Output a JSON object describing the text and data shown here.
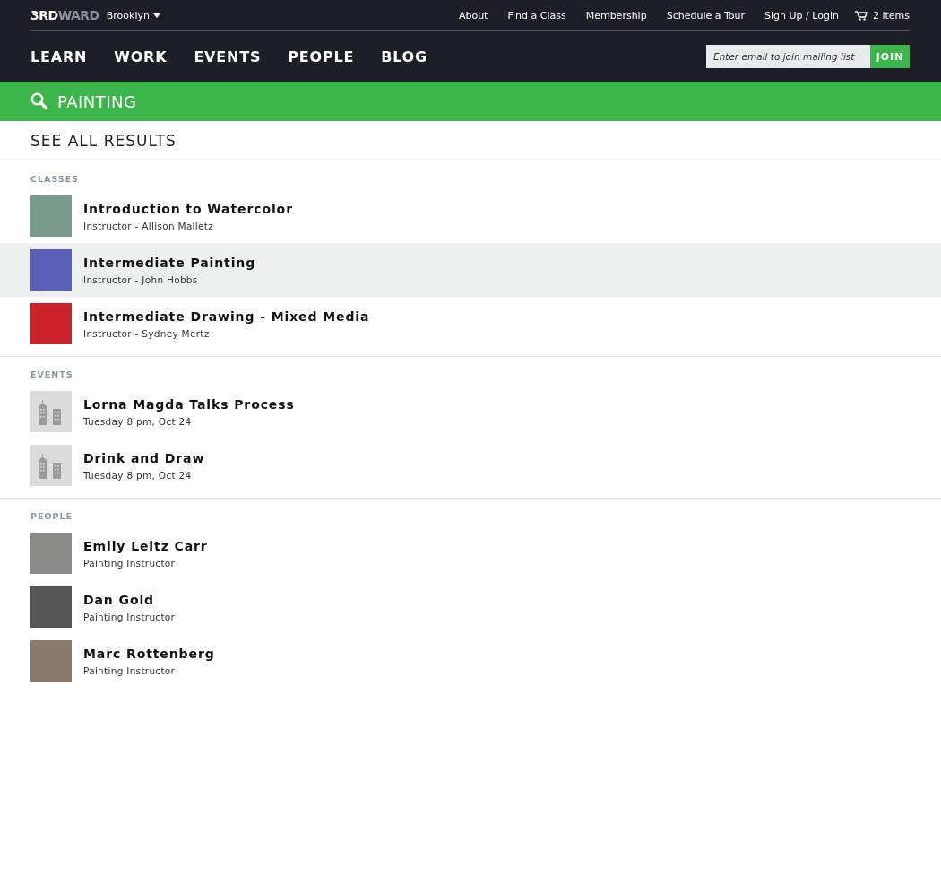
{
  "header": {
    "logo": {
      "light": "3RD",
      "muted": "WARD"
    },
    "location": "Brooklyn",
    "top_links": [
      "About",
      "Find a Class",
      "Membership",
      "Schedule a Tour",
      "Sign Up / Login"
    ],
    "cart": "2 items",
    "nav": [
      "LEARN",
      "WORK",
      "EVENTS",
      "PEOPLE",
      "BLOG"
    ],
    "mailing": {
      "placeholder": "Enter email to join mailing list",
      "button": "JOIN"
    }
  },
  "search": {
    "query": "PAINTING"
  },
  "see_all": "SEE ALL RESULTS",
  "sections": [
    {
      "label": "CLASSES",
      "items": [
        {
          "kind": "photo",
          "title": "Introduction to Watercolor",
          "subtitle": "Instructor - Allison Malletz",
          "highlighted": false,
          "color": "#7a9a8e"
        },
        {
          "kind": "photo",
          "title": "Intermediate Painting",
          "subtitle": "Instructor - John Hobbs",
          "highlighted": true,
          "color": "#5a5fb8"
        },
        {
          "kind": "photo",
          "title": "Intermediate Drawing - Mixed Media",
          "subtitle": "Instructor - Sydney Mertz",
          "highlighted": false,
          "color": "#c8232a"
        }
      ]
    },
    {
      "label": "EVENTS",
      "items": [
        {
          "kind": "building",
          "title": "Lorna Magda Talks Process",
          "subtitle": "Tuesday 8 pm, Oct 24",
          "highlighted": false
        },
        {
          "kind": "building",
          "title": "Drink and Draw",
          "subtitle": "Tuesday 8 pm, Oct 24",
          "highlighted": false
        }
      ]
    },
    {
      "label": "PEOPLE",
      "items": [
        {
          "kind": "photo",
          "title": "Emily Leitz Carr",
          "subtitle": "Painting Instructor",
          "highlighted": false,
          "color": "#8a8a86"
        },
        {
          "kind": "photo",
          "title": "Dan Gold",
          "subtitle": "Painting Instructor",
          "highlighted": false,
          "color": "#555555"
        },
        {
          "kind": "photo",
          "title": "Marc Rottenberg",
          "subtitle": "Painting Instructor",
          "highlighted": false,
          "color": "#8a7a6a"
        }
      ]
    }
  ]
}
